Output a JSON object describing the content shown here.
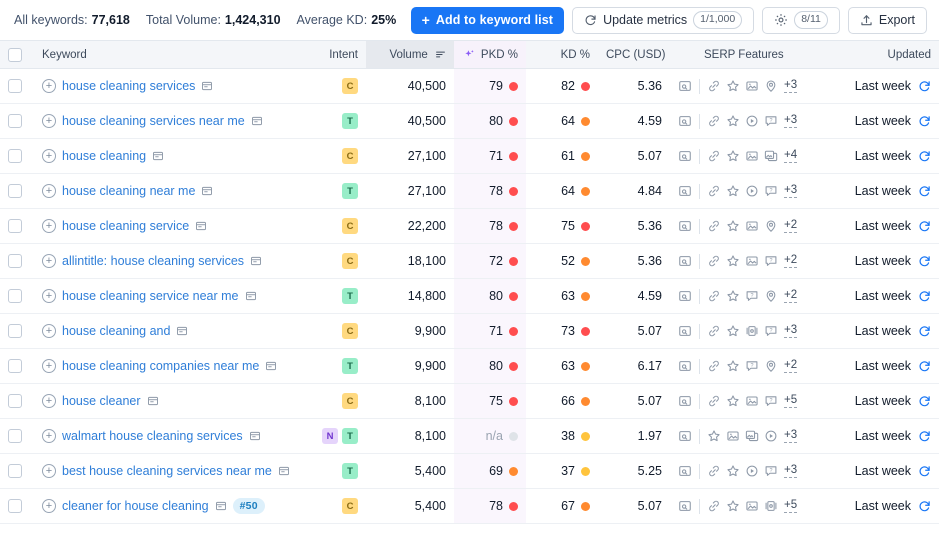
{
  "summary": {
    "all_keywords_label": "All keywords:",
    "all_keywords_value": "77,618",
    "total_volume_label": "Total Volume:",
    "total_volume_value": "1,424,310",
    "average_kd_label": "Average KD:",
    "average_kd_value": "25%"
  },
  "toolbar": {
    "add_to_list_label": "Add to keyword list",
    "add_plus": "+",
    "update_metrics_label": "Update metrics",
    "update_metrics_count": "1/1,000",
    "settings_count": "8/11",
    "export_label": "Export"
  },
  "columns": {
    "keyword": "Keyword",
    "intent": "Intent",
    "volume": "Volume",
    "pkd": "PKD %",
    "kd": "KD %",
    "cpc": "CPC (USD)",
    "serp": "SERP Features",
    "updated": "Updated"
  },
  "colors": {
    "primary_blue": "#1976f5",
    "link_blue": "#2f7ed8",
    "pkd_column_bg": "#faf6fd",
    "dot_red": "#ff4d4f",
    "dot_orange": "#ff8a30",
    "dot_yellow": "#ffc43d",
    "dot_gray": "#dfe3e8",
    "intent_c": "#ffd980",
    "intent_t": "#98edc8",
    "intent_n": "#e5d4fb"
  },
  "rows": [
    {
      "keyword": "house cleaning services",
      "intents": [
        "C"
      ],
      "volume": "40,500",
      "pkd": "79",
      "pkd_level": "red",
      "kd": "82",
      "kd_level": "red",
      "cpc": "5.36",
      "serp_icons": [
        "serp-preview-icon",
        "link-icon",
        "star-icon",
        "image-icon",
        "location-icon"
      ],
      "serp_more": "+3",
      "updated": "Last week",
      "position_badge": null
    },
    {
      "keyword": "house cleaning services near me",
      "intents": [
        "T"
      ],
      "volume": "40,500",
      "pkd": "80",
      "pkd_level": "red",
      "kd": "64",
      "kd_level": "orange",
      "cpc": "4.59",
      "serp_icons": [
        "serp-preview-icon",
        "link-icon",
        "star-icon",
        "video-icon",
        "question-icon"
      ],
      "serp_more": "+3",
      "updated": "Last week",
      "position_badge": null
    },
    {
      "keyword": "house cleaning",
      "intents": [
        "C"
      ],
      "volume": "27,100",
      "pkd": "71",
      "pkd_level": "red",
      "kd": "61",
      "kd_level": "orange",
      "cpc": "5.07",
      "serp_icons": [
        "serp-preview-icon",
        "link-icon",
        "star-icon",
        "image-icon",
        "image-pack-icon"
      ],
      "serp_more": "+4",
      "updated": "Last week",
      "position_badge": null
    },
    {
      "keyword": "house cleaning near me",
      "intents": [
        "T"
      ],
      "volume": "27,100",
      "pkd": "78",
      "pkd_level": "red",
      "kd": "64",
      "kd_level": "orange",
      "cpc": "4.84",
      "serp_icons": [
        "serp-preview-icon",
        "link-icon",
        "star-icon",
        "video-icon",
        "question-icon"
      ],
      "serp_more": "+3",
      "updated": "Last week",
      "position_badge": null
    },
    {
      "keyword": "house cleaning service",
      "intents": [
        "C"
      ],
      "volume": "22,200",
      "pkd": "78",
      "pkd_level": "red",
      "kd": "75",
      "kd_level": "red",
      "cpc": "5.36",
      "serp_icons": [
        "serp-preview-icon",
        "link-icon",
        "star-icon",
        "image-icon",
        "location-icon"
      ],
      "serp_more": "+2",
      "updated": "Last week",
      "position_badge": null
    },
    {
      "keyword": "allintitle: house cleaning services",
      "intents": [
        "C"
      ],
      "volume": "18,100",
      "pkd": "72",
      "pkd_level": "red",
      "kd": "52",
      "kd_level": "orange",
      "cpc": "5.36",
      "serp_icons": [
        "serp-preview-icon",
        "link-icon",
        "star-icon",
        "image-icon",
        "question-icon"
      ],
      "serp_more": "+2",
      "updated": "Last week",
      "position_badge": null
    },
    {
      "keyword": "house cleaning service near me",
      "intents": [
        "T"
      ],
      "volume": "14,800",
      "pkd": "80",
      "pkd_level": "red",
      "kd": "63",
      "kd_level": "orange",
      "cpc": "4.59",
      "serp_icons": [
        "serp-preview-icon",
        "link-icon",
        "star-icon",
        "question-icon",
        "location-icon"
      ],
      "serp_more": "+2",
      "updated": "Last week",
      "position_badge": null
    },
    {
      "keyword": "house cleaning and",
      "intents": [
        "C"
      ],
      "volume": "9,900",
      "pkd": "71",
      "pkd_level": "red",
      "kd": "73",
      "kd_level": "red",
      "cpc": "5.07",
      "serp_icons": [
        "serp-preview-icon",
        "link-icon",
        "star-icon",
        "carousel-icon",
        "question-icon"
      ],
      "serp_more": "+3",
      "updated": "Last week",
      "position_badge": null
    },
    {
      "keyword": "house cleaning companies near me",
      "intents": [
        "T"
      ],
      "volume": "9,900",
      "pkd": "80",
      "pkd_level": "red",
      "kd": "63",
      "kd_level": "orange",
      "cpc": "6.17",
      "serp_icons": [
        "serp-preview-icon",
        "link-icon",
        "star-icon",
        "question-icon",
        "location-icon"
      ],
      "serp_more": "+2",
      "updated": "Last week",
      "position_badge": null
    },
    {
      "keyword": "house cleaner",
      "intents": [
        "C"
      ],
      "volume": "8,100",
      "pkd": "75",
      "pkd_level": "red",
      "kd": "66",
      "kd_level": "orange",
      "cpc": "5.07",
      "serp_icons": [
        "serp-preview-icon",
        "link-icon",
        "star-icon",
        "image-icon",
        "question-icon"
      ],
      "serp_more": "+5",
      "updated": "Last week",
      "position_badge": null
    },
    {
      "keyword": "walmart house cleaning services",
      "intents": [
        "N",
        "T"
      ],
      "volume": "8,100",
      "pkd": "n/a",
      "pkd_level": "gray",
      "kd": "38",
      "kd_level": "yellow",
      "cpc": "1.97",
      "serp_icons": [
        "serp-preview-icon",
        "star-icon",
        "image-icon",
        "image-pack-icon",
        "video-icon"
      ],
      "serp_more": "+3",
      "updated": "Last week",
      "position_badge": null
    },
    {
      "keyword": "best house cleaning services near me",
      "intents": [
        "T"
      ],
      "volume": "5,400",
      "pkd": "69",
      "pkd_level": "orange",
      "kd": "37",
      "kd_level": "yellow",
      "cpc": "5.25",
      "serp_icons": [
        "serp-preview-icon",
        "link-icon",
        "star-icon",
        "video-icon",
        "question-icon"
      ],
      "serp_more": "+3",
      "updated": "Last week",
      "position_badge": null
    },
    {
      "keyword": "cleaner for house cleaning",
      "intents": [
        "C"
      ],
      "volume": "5,400",
      "pkd": "78",
      "pkd_level": "red",
      "kd": "67",
      "kd_level": "orange",
      "cpc": "5.07",
      "serp_icons": [
        "serp-preview-icon",
        "link-icon",
        "star-icon",
        "image-icon",
        "carousel-icon"
      ],
      "serp_more": "+5",
      "updated": "Last week",
      "position_badge": "#50"
    }
  ]
}
